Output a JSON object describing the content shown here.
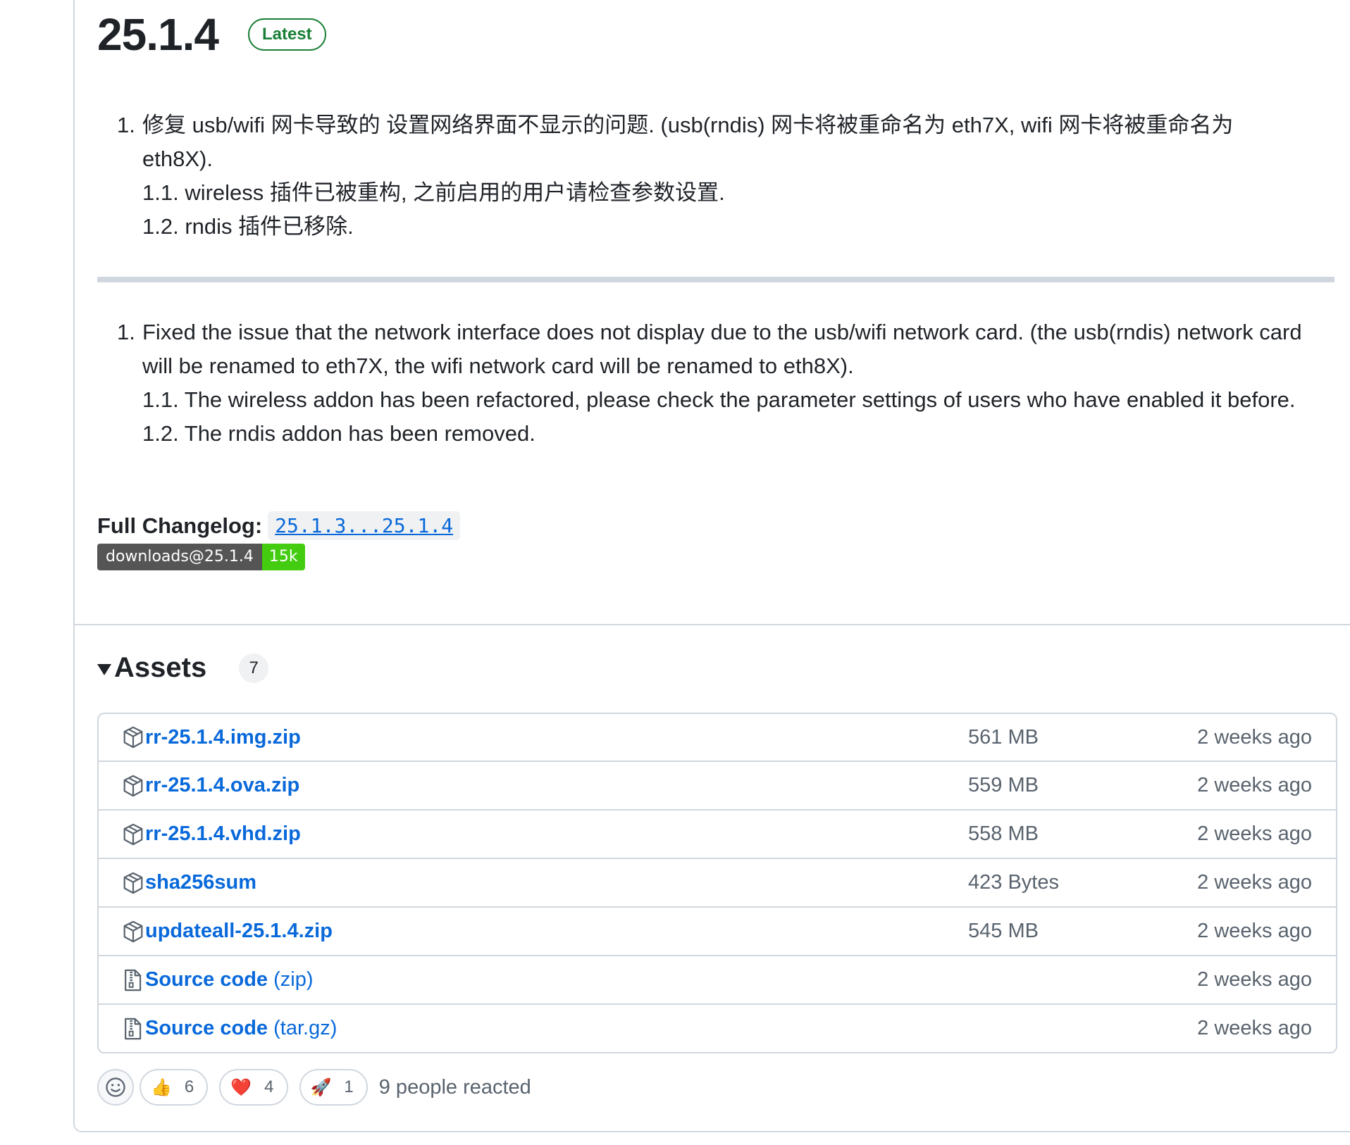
{
  "release": {
    "version": "25.1.4",
    "latest_label": "Latest"
  },
  "notes_cn": {
    "item1": "修复 usb/wifi 网卡导致的 设置网络界面不显示的问题. (usb(rndis) 网卡将被重命名为 eth7X, wifi 网卡将被重命名为 eth8X).",
    "item1_num": "1.",
    "sub1": "1.1. wireless 插件已被重构, 之前启用的用户请检查参数设置.",
    "sub2": "1.2. rndis 插件已移除."
  },
  "notes_en": {
    "item1": "Fixed the issue that the network interface does not display due to the usb/wifi network card. (the usb(rndis) network card will be renamed to eth7X, the wifi network card will be renamed to eth8X).",
    "item1_num": "1.",
    "sub1": "1.1. The wireless addon has been refactored, please check the parameter settings of users who have enabled it before.",
    "sub2": "1.2. The rndis addon has been removed."
  },
  "changelog": {
    "label": "Full Changelog",
    "colon": ":",
    "link": "25.1.3...25.1.4"
  },
  "downloads_badge": {
    "left": "downloads@25.1.4",
    "right": "15k"
  },
  "assets": {
    "title": "Assets",
    "count": "7",
    "items": [
      {
        "name": "rr-25.1.4.img.zip",
        "size": "561 MB",
        "date": "2 weeks ago",
        "icon": "package-icon"
      },
      {
        "name": "rr-25.1.4.ova.zip",
        "size": "559 MB",
        "date": "2 weeks ago",
        "icon": "package-icon"
      },
      {
        "name": "rr-25.1.4.vhd.zip",
        "size": "558 MB",
        "date": "2 weeks ago",
        "icon": "package-icon"
      },
      {
        "name": "sha256sum",
        "size": "423 Bytes",
        "date": "2 weeks ago",
        "icon": "package-icon"
      },
      {
        "name": "updateall-25.1.4.zip",
        "size": "545 MB",
        "date": "2 weeks ago",
        "icon": "package-icon"
      },
      {
        "name": "Source code",
        "ext": "(zip)",
        "size": "",
        "date": "2 weeks ago",
        "icon": "file-zip-icon"
      },
      {
        "name": "Source code",
        "ext": "(tar.gz)",
        "size": "",
        "date": "2 weeks ago",
        "icon": "file-zip-icon"
      }
    ]
  },
  "reactions": {
    "thumbs_up": {
      "emoji": "👍",
      "count": "6"
    },
    "heart": {
      "emoji": "❤️",
      "count": "4"
    },
    "rocket": {
      "emoji": "🚀",
      "count": "1"
    },
    "summary": "9 people reacted"
  },
  "colors": {
    "link": "#0969da",
    "latest": "#1a7f37",
    "badge_green": "#44cc11"
  }
}
